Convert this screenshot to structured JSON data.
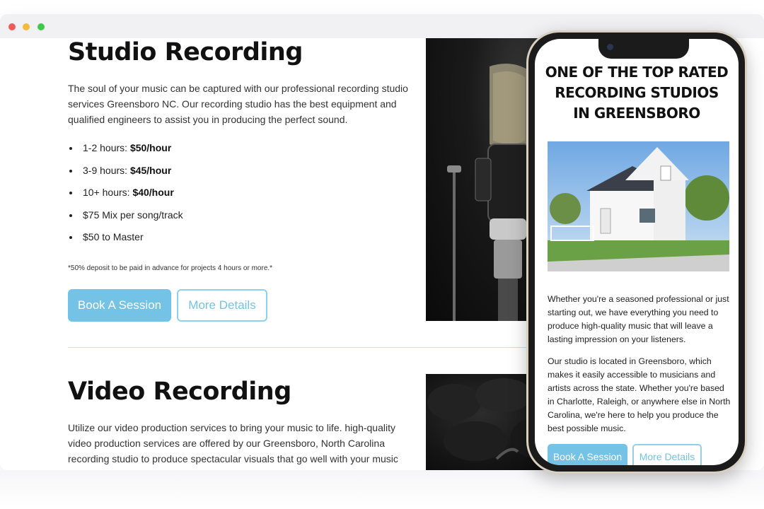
{
  "browser": {
    "controls": [
      "close",
      "minimize",
      "maximize"
    ]
  },
  "studio": {
    "title": "Studio Recording",
    "description": "The soul of your music can be captured with our professional recording studio services Greensboro NC. Our recording studio has the best equipment and qualified engineers to assist you in producing the perfect sound.",
    "prices": [
      {
        "label": "1-2 hours: ",
        "value": "$50/hour"
      },
      {
        "label": "3-9 hours: ",
        "value": "$45/hour"
      },
      {
        "label": "10+ hours: ",
        "value": "$40/hour"
      },
      {
        "label": "$75 Mix per song/track",
        "value": ""
      },
      {
        "label": "$50 to Master",
        "value": ""
      }
    ],
    "note": "*50% deposit to be paid in advance for projects 4 hours or more.*",
    "book_label": "Book A Session",
    "more_label": "More Details"
  },
  "video": {
    "title": "Video Recording",
    "description": "Utilize our video production services to bring your music to life. high-quality video production services are offered by our Greensboro, North Carolina recording studio to produce spectacular visuals that go well with your music and"
  },
  "phone": {
    "heading": "ONE OF THE TOP RATED\nRECORDING STUDIOS\nIN GREENSBORO",
    "para1": "Whether you're a seasoned professional or just starting out, we have everything you need to produce high-quality music that will leave a lasting impression on your listeners.",
    "para2": "Our studio is located in Greensboro, which makes it easily accessible to musicians and artists across the state. Whether you're based in Charlotte, Raleigh, or anywhere else in North Carolina, we're here to help you produce the best possible music.",
    "book_label": "Book A Session",
    "more_label": "More Details"
  },
  "colors": {
    "accent": "#74c3e6",
    "divider": "#bfe3f2"
  }
}
